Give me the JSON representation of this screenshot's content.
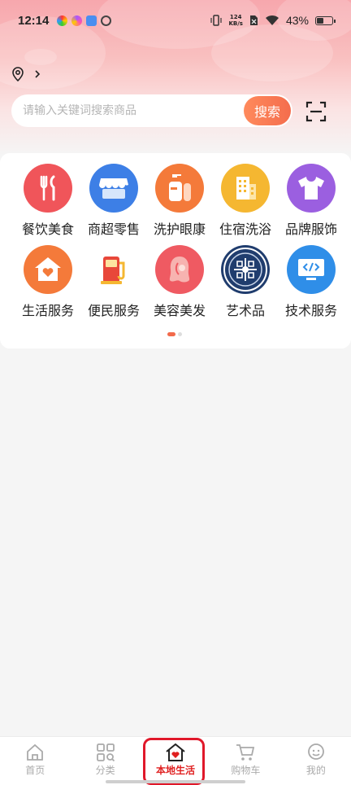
{
  "status_bar": {
    "time": "12:14",
    "net_speed_value": "124",
    "net_speed_unit": "KB/s",
    "battery": "43%"
  },
  "location": {
    "label": "",
    "icon": "location-pin-icon"
  },
  "search": {
    "placeholder": "请输入关键词搜索商品",
    "button": "搜索"
  },
  "categories": [
    {
      "label": "餐饮美食",
      "icon": "fork-knife-icon",
      "color": "#f0555a"
    },
    {
      "label": "商超零售",
      "icon": "store-icon",
      "color": "#3d7fe6"
    },
    {
      "label": "洗护眼康",
      "icon": "bottles-icon",
      "color": "#f47a3a"
    },
    {
      "label": "住宿洗浴",
      "icon": "building-icon",
      "color": "#f5b731"
    },
    {
      "label": "品牌服饰",
      "icon": "tshirt-icon",
      "color": "#9b5fe0"
    },
    {
      "label": "生活服务",
      "icon": "house-heart-icon",
      "color": "#f47a3a"
    },
    {
      "label": "便民服务",
      "icon": "gas-pump-icon",
      "color": "#e8473a"
    },
    {
      "label": "美容美发",
      "icon": "woman-hair-icon",
      "color": "#ef5a62"
    },
    {
      "label": "艺术品",
      "icon": "pattern-medallion-icon",
      "color": "#203d6e"
    },
    {
      "label": "技术服务",
      "icon": "monitor-code-icon",
      "color": "#2f8ee8"
    }
  ],
  "pager": {
    "pages": 2,
    "current": 1
  },
  "tabbar": [
    {
      "label": "首页",
      "icon": "home-icon"
    },
    {
      "label": "分类",
      "icon": "grid-search-icon"
    },
    {
      "label": "本地生活",
      "icon": "local-life-icon",
      "active": true
    },
    {
      "label": "购物车",
      "icon": "cart-icon"
    },
    {
      "label": "我的",
      "icon": "profile-icon"
    }
  ]
}
